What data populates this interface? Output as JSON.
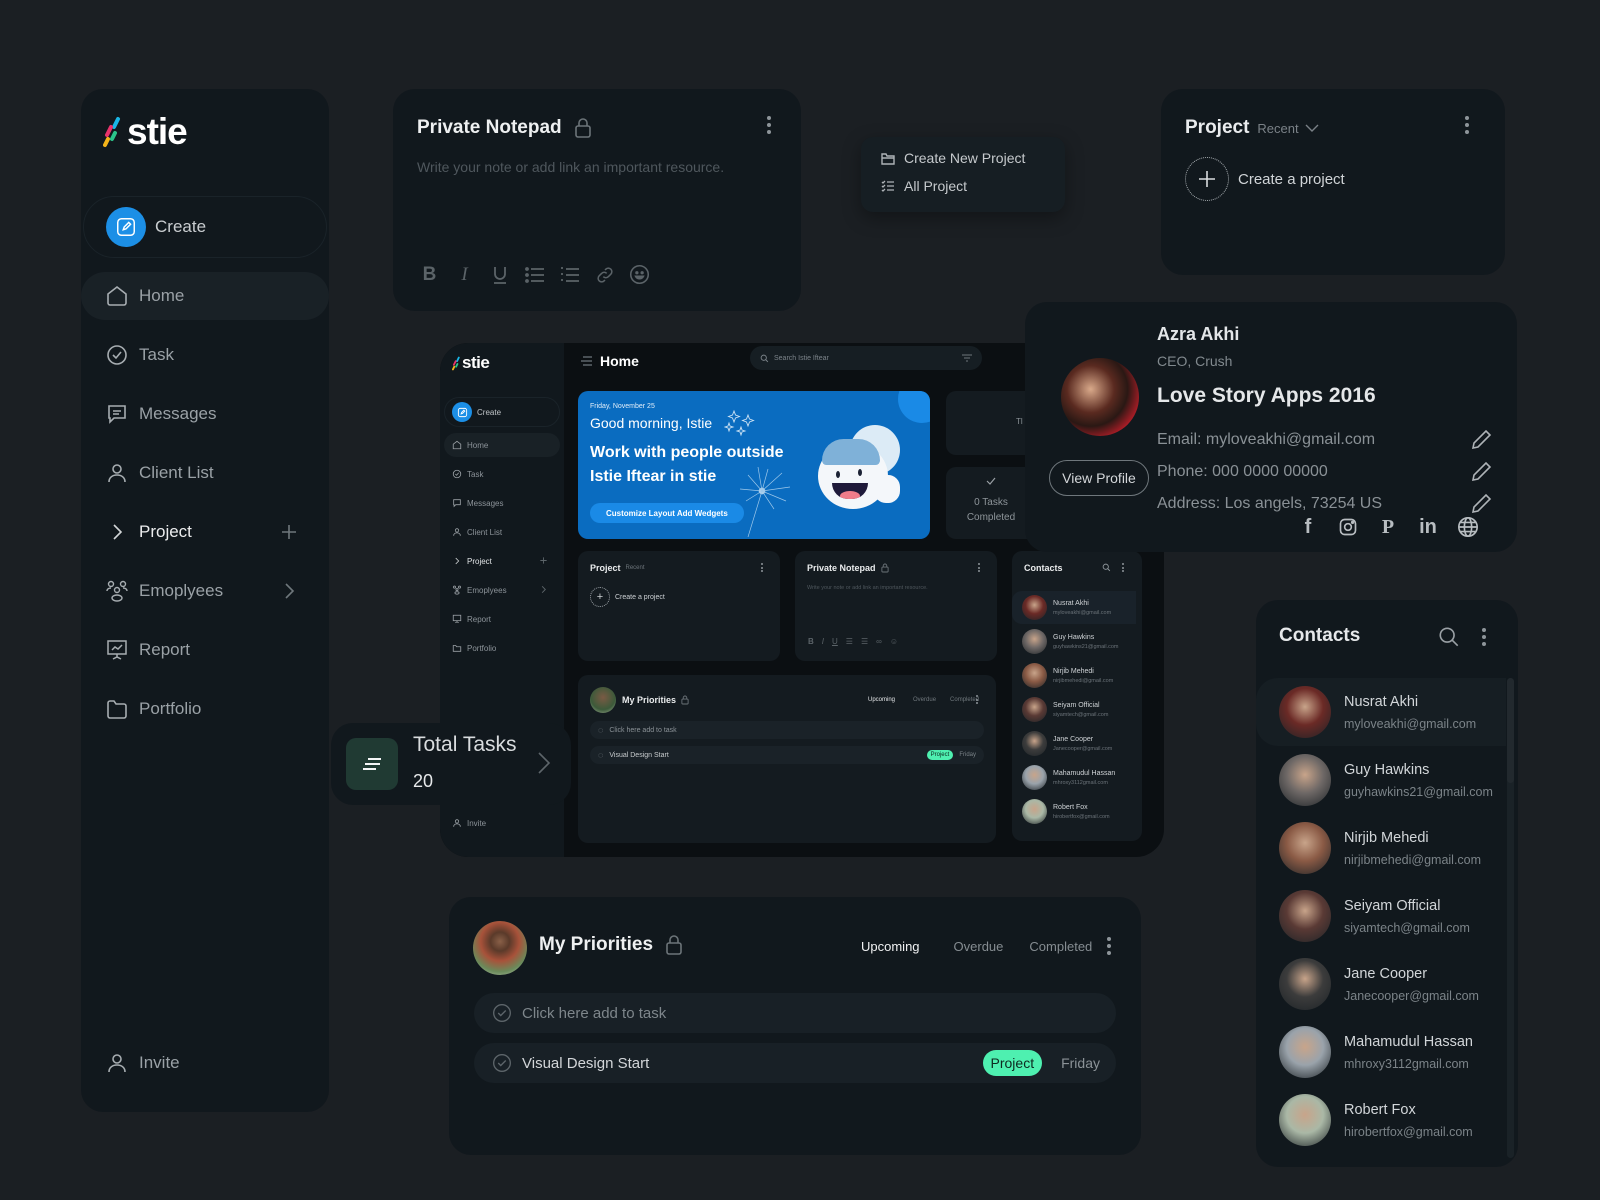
{
  "colors": {
    "accent": "#1c8fe6",
    "banner": "#0a6cc0",
    "badge": "#4ef0b0",
    "bg": "#1b1f23",
    "card": "#11181d"
  },
  "sidebar": {
    "logo": "stie",
    "create_label": "Create",
    "items": [
      {
        "label": "Home",
        "icon": "home-icon"
      },
      {
        "label": "Task",
        "icon": "check-circle-icon"
      },
      {
        "label": "Messages",
        "icon": "message-icon"
      },
      {
        "label": "Client List",
        "icon": "user-icon"
      },
      {
        "label": "Project",
        "icon": "chevron-right-icon",
        "action": "plus-icon"
      },
      {
        "label": "Emoplyees",
        "icon": "users-icon",
        "action": "chevron-right-icon"
      },
      {
        "label": "Report",
        "icon": "presentation-icon"
      },
      {
        "label": "Portfolio",
        "icon": "folder-icon"
      }
    ],
    "invite_label": "Invite"
  },
  "notepad": {
    "title": "Private Notepad",
    "placeholder": "Write your note or add link an important resource.",
    "tools": [
      "bold-icon",
      "italic-icon",
      "underline-icon",
      "bullet-list-icon",
      "numbered-list-icon",
      "link-icon",
      "emoji-icon"
    ]
  },
  "project_menu": {
    "items": [
      {
        "label": "Create New Project",
        "icon": "folder-open-icon"
      },
      {
        "label": "All Project",
        "icon": "checklist-icon"
      }
    ]
  },
  "project_card": {
    "title": "Project",
    "filter": "Recent",
    "create_label": "Create a project"
  },
  "profile": {
    "name": "Azra Akhi",
    "role": "CEO, Crush",
    "project": "Love Story Apps 2016",
    "email": "Email: myloveakhi@gmail.com",
    "phone": "Phone: 000 0000 00000",
    "address": "Address: Los angels, 73254 US",
    "view_profile": "View Profile",
    "social": [
      "facebook-icon",
      "instagram-icon",
      "pinterest-icon",
      "linkedin-icon",
      "globe-icon"
    ]
  },
  "total_tasks": {
    "label": "Total Tasks",
    "value": "20"
  },
  "priorities": {
    "title": "My Priorities",
    "tabs": [
      "Upcoming",
      "Overdue",
      "Completed"
    ],
    "active_tab": "Upcoming",
    "add_placeholder": "Click here add to task",
    "tasks": [
      {
        "name": "Visual Design Start",
        "tag": "Project",
        "day": "Friday"
      }
    ]
  },
  "contacts": {
    "title": "Contacts",
    "items": [
      {
        "name": "Nusrat Akhi",
        "email": "myloveakhi@gmail.com",
        "avatar": "#6b2a26"
      },
      {
        "name": "Guy Hawkins",
        "email": "guyhawkins21@gmail.com",
        "avatar": "#6e6866"
      },
      {
        "name": "Nirjib Mehedi",
        "email": "nirjibmehedi@gmail.com",
        "avatar": "#8a5a45"
      },
      {
        "name": "Seiyam Official",
        "email": "siyamtech@gmail.com",
        "avatar": "#5a3a35"
      },
      {
        "name": "Jane Cooper",
        "email": "Janecooper@gmail.com",
        "avatar": "#3c3c3c"
      },
      {
        "name": "Mahamudul Hassan",
        "email": "mhroxy3112gmail.com",
        "avatar": "#9aa3ab"
      },
      {
        "name": "Robert Fox",
        "email": "hirobertfox@gmail.com",
        "avatar": "#aab8a6"
      }
    ]
  },
  "mockup": {
    "logo": "stie",
    "create_label": "Create",
    "nav": [
      "Home",
      "Task",
      "Messages",
      "Client List",
      "Project",
      "Emoplyees",
      "Report",
      "Portfolio"
    ],
    "invite": "Invite",
    "header_title": "Home",
    "search_placeholder": "Search Istie Iftear",
    "banner": {
      "date": "Friday, November 25",
      "greeting": "Good morning, Istie",
      "headline_1": "Work with people outside",
      "headline_2": "Istie Iftear in stie",
      "cta": "Customize Layout Add Wedgets"
    },
    "tasks_completed_1": "0 Tasks",
    "tasks_completed_2": "Completed",
    "mini_label": "Tl",
    "project": {
      "title": "Project",
      "filter": "Recent",
      "create": "Create a project"
    },
    "notepad": {
      "title": "Private Notepad",
      "placeholder": "Write your note or add link an important resource."
    },
    "contacts_title": "Contacts",
    "priorities": {
      "title": "My Priorities",
      "tabs": [
        "Upcoming",
        "Overdue",
        "Completed"
      ],
      "add": "Click here add to task",
      "task": "Visual Design Start",
      "tag": "Project",
      "day": "Friday"
    }
  }
}
